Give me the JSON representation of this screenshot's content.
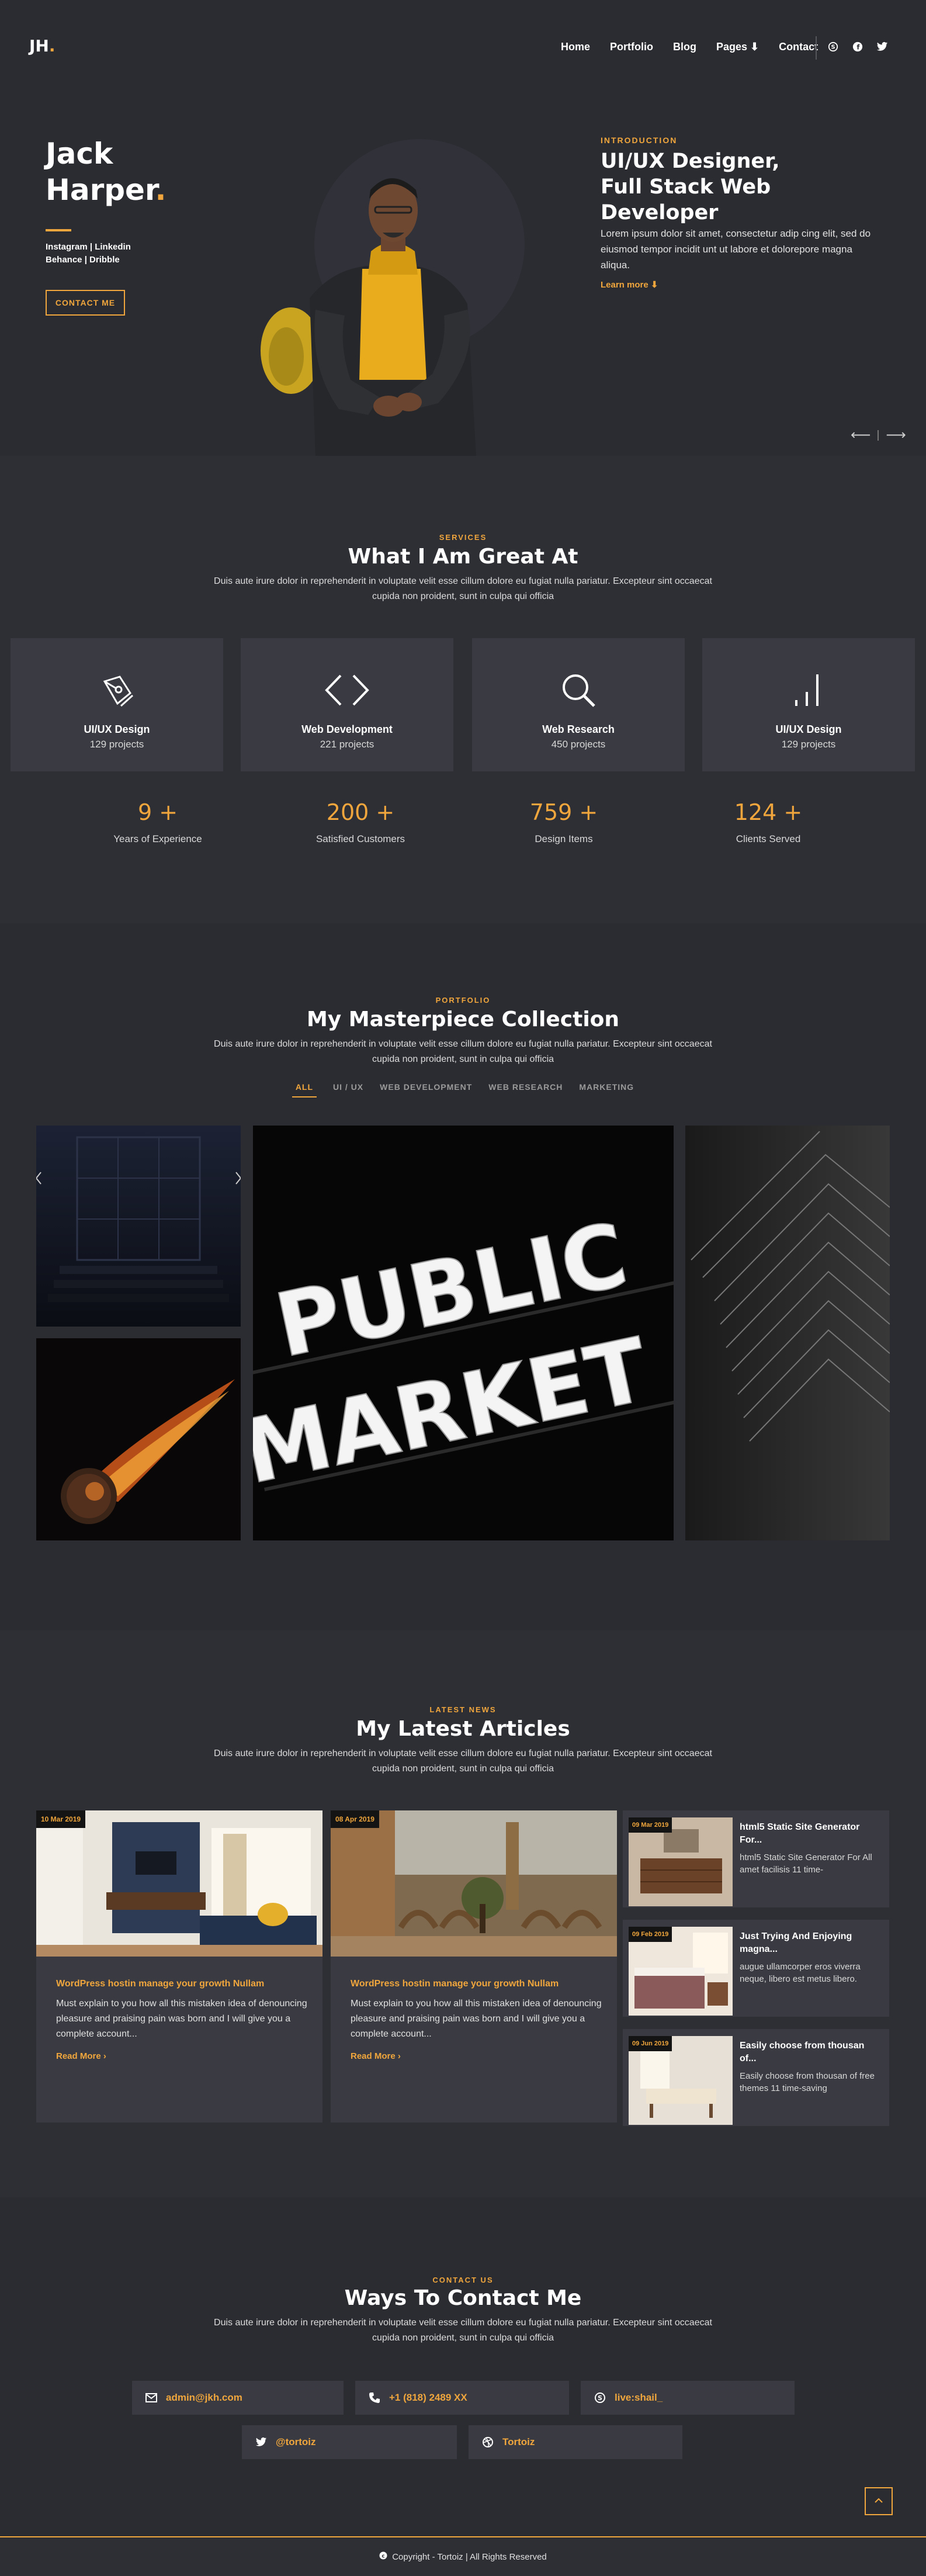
{
  "nav": {
    "logo_text": "JH",
    "logo_dot": ".",
    "menu": [
      "Home",
      "Portfolio",
      "Blog",
      "Pages ⬇",
      "Contact"
    ],
    "social_icons": [
      "skype-icon",
      "facebook-icon",
      "twitter-icon"
    ]
  },
  "hero": {
    "first_name": "Jack",
    "last_name": "Harper",
    "name_dot": ".",
    "links_line1": "Instagram | Linkedin",
    "links_line2": "Behance | Dribble",
    "contact_button": "CONTACT ME",
    "intro_label": "INTRODUCTION",
    "title": "UI/UX Designer, Full Stack Web Developer",
    "text": "Lorem ipsum dolor sit amet, consectetur adip cing elit, sed do eiusmod tempor incidit unt ut labore et dolorepore magna aliqua.",
    "learn_more": "Learn more ⬇",
    "prev_arrow": "⟵",
    "next_arrow": "⟶"
  },
  "services": {
    "label": "SERVICES",
    "title": "What I Am Great At",
    "desc": "Duis aute irure dolor in reprehenderit in voluptate velit esse cillum dolore eu fugiat nulla pariatur. Excepteur sint occaecat cupida non proident, sunt in culpa qui officia",
    "items": [
      {
        "icon": "pen-tool-icon",
        "title": "UI/UX Design",
        "count": "129 projects"
      },
      {
        "icon": "code-icon",
        "title": "Web Development",
        "count": "221 projects"
      },
      {
        "icon": "search-icon",
        "title": "Web Research",
        "count": "450 projects"
      },
      {
        "icon": "bar-chart-icon",
        "title": "UI/UX Design",
        "count": "129 projects"
      }
    ],
    "stats": [
      {
        "number": "9 +",
        "label": "Years of Experience"
      },
      {
        "number": "200 +",
        "label": "Satisfied Customers"
      },
      {
        "number": "759 +",
        "label": "Design Items"
      },
      {
        "number": "124 +",
        "label": "Clients Served"
      }
    ]
  },
  "portfolio": {
    "label": "PORTFOLIO",
    "title": "My Masterpiece Collection",
    "desc": "Duis aute irure dolor in reprehenderit in voluptate velit esse cillum dolore eu fugiat nulla pariatur. Excepteur sint occaecat cupida non proident, sunt in culpa qui officia",
    "tabs": [
      "ALL",
      "UI / UX",
      "WEB DEVELOPMENT",
      "WEB RESEARCH",
      "MARKETING"
    ],
    "sign_text_top": "PUBLIC",
    "sign_text_bottom": "MARKET"
  },
  "articles": {
    "label": "LATEST NEWS",
    "title": "My Latest Articles",
    "desc": "Duis aute irure dolor in reprehenderit in voluptate velit esse cillum dolore eu fugiat nulla pariatur. Excepteur sint occaecat cupida non proident, sunt in culpa qui officia",
    "main": [
      {
        "date": "10 Mar 2019",
        "title": "WordPress hostin manage your growth Nullam",
        "text": "Must explain to you how all this mistaken idea of denouncing pleasure and praising pain was born and I will give you a complete account...",
        "read": "Read More"
      },
      {
        "date": "08 Apr 2019",
        "title": "WordPress hostin manage your growth Nullam",
        "text": "Must explain to you how all this mistaken idea of denouncing pleasure and praising pain was born and I will give you a complete account...",
        "read": "Read More"
      }
    ],
    "side": [
      {
        "date": "09 Mar 2019",
        "title": "html5 Static Site Generator For...",
        "text": "html5 Static Site Generator For All amet facilisis 11 time-"
      },
      {
        "date": "09 Feb 2019",
        "title": "Just Trying And Enjoying magna...",
        "text": "augue ullamcorper eros viverra neque, libero est metus libero."
      },
      {
        "date": "09 Jun 2019",
        "title": "Easily choose from thousan of...",
        "text": "Easily choose from thousan of free themes 11 time-saving"
      }
    ]
  },
  "contact": {
    "label": "CONTACT US",
    "title": "Ways To Contact Me",
    "desc": "Duis aute irure dolor in reprehenderit in voluptate velit esse cillum dolore eu fugiat nulla pariatur. Excepteur sint occaecat cupida non proident, sunt in culpa qui officia",
    "email": "admin@jkh.com",
    "phone": "+1 (818) 2489 XX",
    "skype": "live:shail_",
    "twitter": "@tortoiz",
    "dribbble": "Tortoiz"
  },
  "footer": {
    "copyright": "Copyright - Tortoiz | All Rights Reserved"
  },
  "colors": {
    "accent": "#f0a63c",
    "background": "#2b2c31",
    "card": "#3a3b42"
  }
}
